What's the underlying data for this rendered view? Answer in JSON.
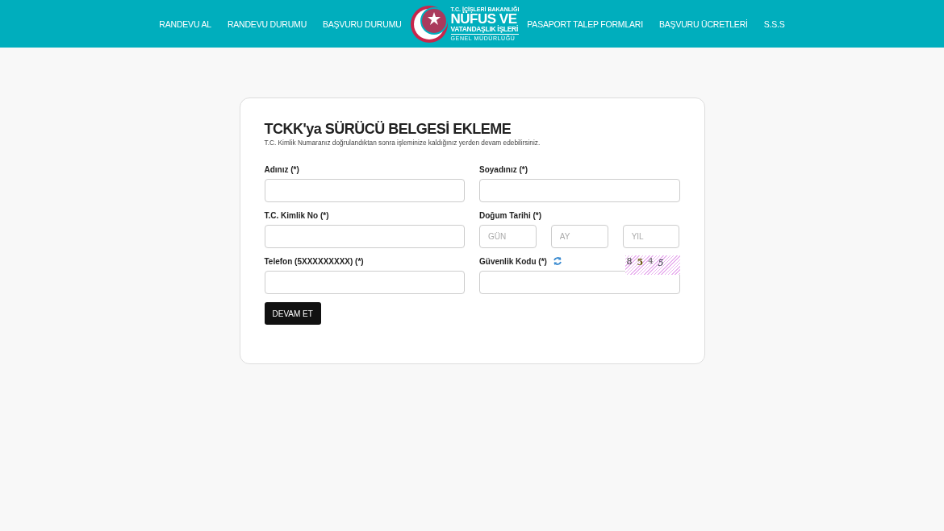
{
  "nav_left": [
    "RANDEVU AL",
    "RANDEVU DURUMU",
    "BAŞVURU DURUMU"
  ],
  "logo": {
    "top": "T.C. İÇİŞLERİ BAKANLIĞI",
    "line1": "NÜFUS VE",
    "line2": "VATANDAŞLIK İŞLERİ",
    "line3": "GENEL MÜDÜRLÜĞÜ"
  },
  "nav_right": [
    "PASAPORT TALEP FORMLARI",
    "BAŞVURU ÜCRETLERİ",
    "S.S.S"
  ],
  "form": {
    "title": "TCKK'ya SÜRÜCÜ BELGESİ EKLEME",
    "subtitle": "T.C. Kimlik Numaranız doğrulandıktan sonra işleminize kaldığınız yerden devam edebilirsiniz.",
    "fields": [
      {
        "kind": "text",
        "label": "Adınız (*)"
      },
      {
        "kind": "text",
        "label": "Soyadınız (*)"
      },
      {
        "kind": "text",
        "label": "T.C. Kimlik No (*)"
      },
      {
        "kind": "date",
        "label": "Doğum Tarihi (*)",
        "placeholders": [
          "GÜN",
          "AY",
          "YIL"
        ]
      },
      {
        "kind": "text",
        "label": "Telefon (5XXXXXXXXX) (*)"
      },
      {
        "kind": "captcha",
        "label": "Güvenlik Kodu (*)",
        "captcha": [
          "8",
          "5",
          "4",
          "5"
        ]
      }
    ],
    "submit": "DEVAM ET"
  }
}
